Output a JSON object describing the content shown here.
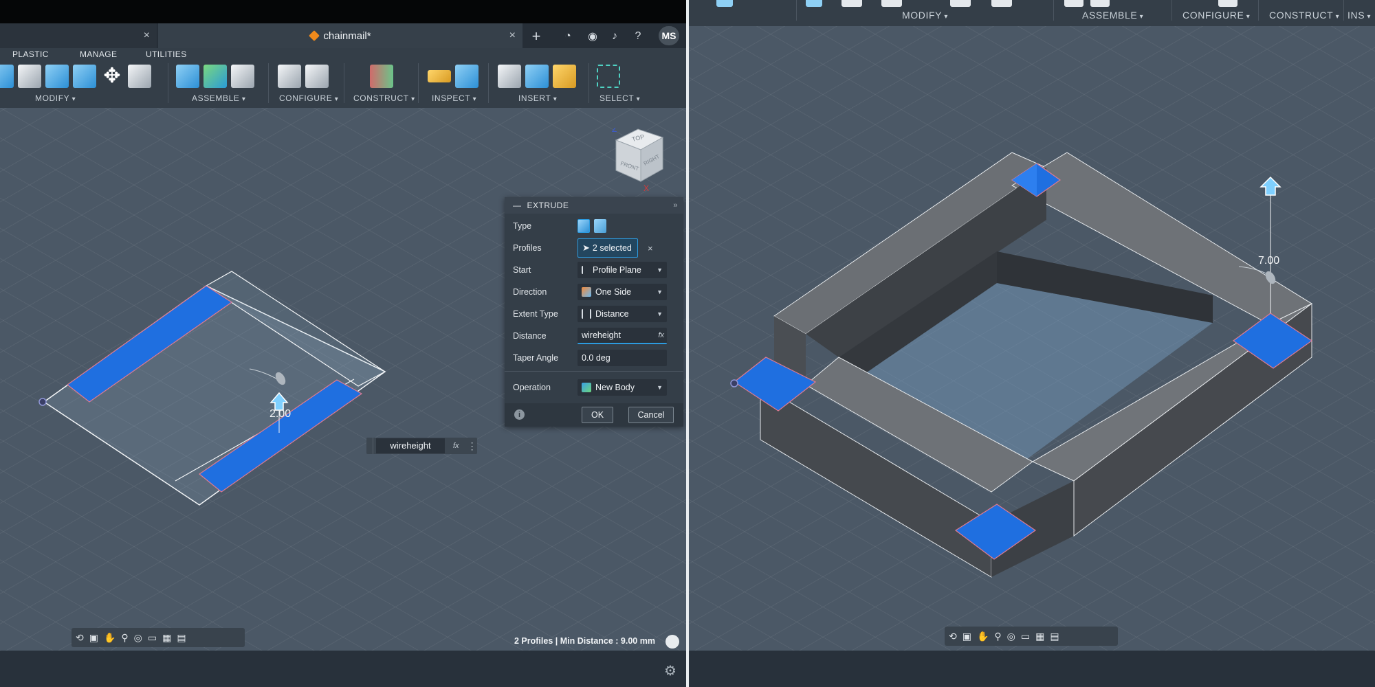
{
  "left": {
    "document_tab": {
      "inactive_close": "×",
      "title": "chainmail*",
      "close": "×"
    },
    "titlebar_icons": {
      "new_tab": "+",
      "avatar": "MS"
    },
    "ribbon_tabs": [
      "PLASTIC",
      "MANAGE",
      "UTILITIES"
    ],
    "groups": {
      "modify": "MODIFY",
      "assemble": "ASSEMBLE",
      "configure": "CONFIGURE",
      "construct": "CONSTRUCT",
      "inspect": "INSPECT",
      "insert": "INSERT",
      "select": "SELECT"
    },
    "viewcube": {
      "face_top": "TOP",
      "face_front": "FRONT",
      "face_right": "RIGHT",
      "axis_z": "Z",
      "axis_x": "X"
    },
    "dimension": "2.00",
    "float_input": {
      "value": "wireheight",
      "fx": "fx"
    },
    "extrude": {
      "title": "EXTRUDE",
      "rows": {
        "type": "Type",
        "profiles": "Profiles",
        "profiles_value": "2 selected",
        "start": "Start",
        "start_value": "Profile Plane",
        "direction": "Direction",
        "direction_value": "One Side",
        "extent_type": "Extent Type",
        "extent_value": "Distance",
        "distance": "Distance",
        "distance_value": "wireheight",
        "taper_angle": "Taper Angle",
        "taper_value": "0.0 deg",
        "operation": "Operation",
        "operation_value": "New Body"
      },
      "ok": "OK",
      "cancel": "Cancel",
      "fx": "fx"
    },
    "status": "2 Profiles | Min Distance : 9.00 mm"
  },
  "right": {
    "groups": {
      "modify": "MODIFY",
      "assemble": "ASSEMBLE",
      "configure": "CONFIGURE",
      "construct": "CONSTRUCT",
      "insert_partial": "INS"
    },
    "dimension": "7.00"
  },
  "colors": {
    "accent": "#2c9be0",
    "profile_blue": "#1f6fe0",
    "viewport": "#4b5866",
    "panel": "#343e48"
  }
}
